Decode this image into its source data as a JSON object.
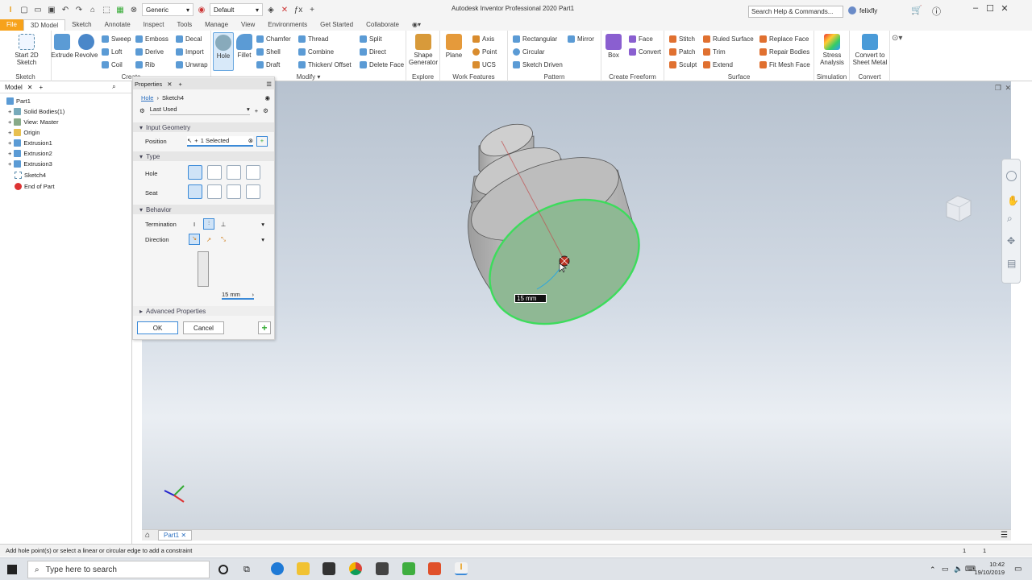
{
  "titlebar": {
    "title": "Autodesk Inventor Professional 2020   Part1",
    "material_combo": "Generic",
    "appearance_combo": "Default",
    "search_placeholder": "Search Help & Commands...",
    "user": "felixfly"
  },
  "tabs": [
    "File",
    "3D Model",
    "Sketch",
    "Annotate",
    "Inspect",
    "Tools",
    "Manage",
    "View",
    "Environments",
    "Get Started",
    "Collaborate"
  ],
  "ribbon": {
    "sketch": {
      "start": "Start 2D Sketch",
      "label": "Sketch"
    },
    "create": {
      "extrude": "Extrude",
      "revolve": "Revolve",
      "sweep": "Sweep",
      "emboss": "Emboss",
      "decal": "Decal",
      "loft": "Loft",
      "derive": "Derive",
      "import": "Import",
      "coil": "Coil",
      "rib": "Rib",
      "unwrap": "Unwrap",
      "label": "Create"
    },
    "modify": {
      "hole": "Hole",
      "fillet": "Fillet",
      "chamfer": "Chamfer",
      "thread": "Thread",
      "split": "Split",
      "shell": "Shell",
      "combine": "Combine",
      "direct": "Direct",
      "draft": "Draft",
      "thicken": "Thicken/ Offset",
      "delete_face": "Delete Face",
      "label": "Modify"
    },
    "explore": {
      "shape_generator": "Shape Generator",
      "label": "Explore"
    },
    "work": {
      "plane": "Plane",
      "axis": "Axis",
      "point": "Point",
      "ucs": "UCS",
      "label": "Work Features"
    },
    "pattern": {
      "rectangular": "Rectangular",
      "mirror": "Mirror",
      "circular": "Circular",
      "sketch_driven": "Sketch Driven",
      "label": "Pattern"
    },
    "freeform": {
      "box": "Box",
      "face": "Face",
      "convert": "Convert",
      "label": "Create Freeform"
    },
    "surface": {
      "stitch": "Stitch",
      "ruled": "Ruled Surface",
      "replace": "Replace Face",
      "patch": "Patch",
      "trim": "Trim",
      "repair": "Repair Bodies",
      "sculpt": "Sculpt",
      "extend": "Extend",
      "fit_mesh": "Fit Mesh Face",
      "label": "Surface"
    },
    "simulation": {
      "stress": "Stress Analysis",
      "label": "Simulation"
    },
    "convert": {
      "sheet_metal": "Convert to Sheet Metal",
      "label": "Convert"
    }
  },
  "browser": {
    "tab": "Model",
    "items": [
      "Part1",
      "Solid Bodies(1)",
      "View: Master",
      "Origin",
      "Extrusion1",
      "Extrusion2",
      "Extrusion3",
      "Sketch4",
      "End of Part"
    ]
  },
  "properties": {
    "tab": "Properties",
    "breadcrumb_link": "Hole",
    "breadcrumb_current": "Sketch4",
    "preset": "Last Used",
    "section_input": "Input Geometry",
    "position_label": "Position",
    "position_value": "1 Selected",
    "section_type": "Type",
    "hole_label": "Hole",
    "seat_label": "Seat",
    "section_behavior": "Behavior",
    "termination_label": "Termination",
    "direction_label": "Direction",
    "depth_value": "15 mm",
    "section_advanced": "Advanced Properties",
    "ok": "OK",
    "cancel": "Cancel"
  },
  "viewport": {
    "dimension_value": "15 mm",
    "doc_tab": "Part1"
  },
  "status": {
    "message": "Add hole point(s) or select a linear or circular edge to add a constraint",
    "count_a": "1",
    "count_b": "1"
  },
  "taskbar": {
    "search_placeholder": "Type here to search",
    "time": "10:42",
    "date": "19/10/2019"
  },
  "colors": {
    "file_tab": "#f7a21b",
    "face_highlight": "#8fb894",
    "edge_highlight": "#3ddc5c",
    "accent_blue": "#3b8ad8"
  }
}
